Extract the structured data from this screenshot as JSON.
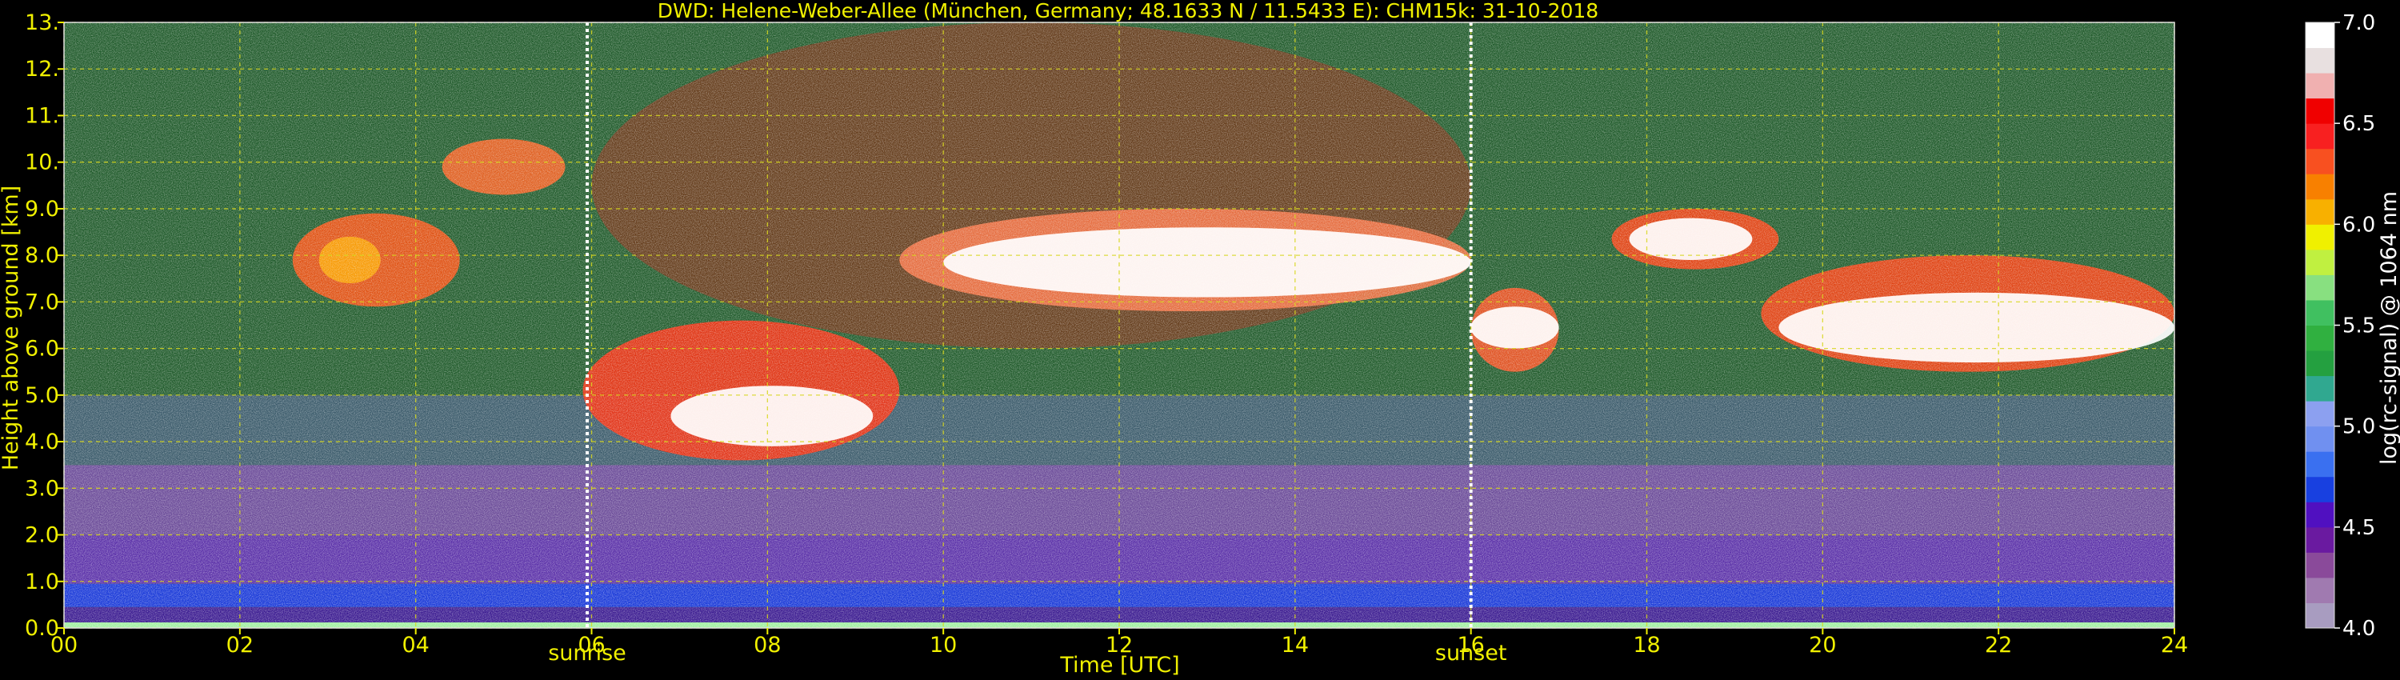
{
  "chart_data": {
    "type": "heatmap",
    "title": "DWD: Helene-Weber-Allee (München, Germany; 48.1633 N / 11.5433 E):    CHM15k: 31-10-2018",
    "xlabel": "Time [UTC]",
    "ylabel": "Height above ground [km]",
    "xlim": [
      0,
      24
    ],
    "ylim": [
      0,
      13
    ],
    "x_ticks": [
      "00",
      "02",
      "04",
      "06",
      "08",
      "10",
      "12",
      "14",
      "16",
      "18",
      "20",
      "22",
      "24"
    ],
    "y_ticks": [
      "0.0",
      "1.0",
      "2.0",
      "3.0",
      "4.0",
      "5.0",
      "6.0",
      "7.0",
      "8.0",
      "9.0",
      "10.",
      "11.",
      "12.",
      "13."
    ],
    "grid": true,
    "events": [
      {
        "label": "sunrise",
        "time": 5.95
      },
      {
        "label": "sunset",
        "time": 16.0
      }
    ],
    "colorbar": {
      "label": "log(rc-signal) @ 1064 nm",
      "range": [
        4.0,
        7.0
      ],
      "ticks": [
        "4.0",
        "4.5",
        "5.0",
        "5.5",
        "6.0",
        "6.5",
        "7.0"
      ],
      "colors": [
        "#a89cc0",
        "#a07ab0",
        "#8a4a9a",
        "#6a1aa0",
        "#5010c0",
        "#1840e0",
        "#3a70f0",
        "#7090f0",
        "#8ca0f0",
        "#30a890",
        "#24a040",
        "#30b040",
        "#40c060",
        "#88e080",
        "#c0f040",
        "#f0f000",
        "#f8b000",
        "#f88000",
        "#f85020",
        "#f82020",
        "#f00000",
        "#f0b0b0",
        "#e8e0e0",
        "#ffffff"
      ]
    },
    "background_bands": [
      {
        "from": 0.0,
        "to": 0.12,
        "color": "#a0f0a0"
      },
      {
        "from": 0.12,
        "to": 0.45,
        "color": "#3a1a90"
      },
      {
        "from": 0.45,
        "to": 0.95,
        "color": "#1838d8"
      },
      {
        "from": 0.95,
        "to": 2.0,
        "color": "#5a30a8"
      },
      {
        "from": 2.0,
        "to": 3.5,
        "color": "#6a4a98"
      },
      {
        "from": 3.5,
        "to": 5.0,
        "color": "#3a5a6a"
      },
      {
        "from": 5.0,
        "to": 13.0,
        "color": "#1f5a2a"
      }
    ],
    "signal_regions": [
      {
        "name": "daytime noise",
        "t0": 6.0,
        "t1": 16.0,
        "h0": 6.0,
        "h1": 13.0,
        "color": "#6a3a1a"
      },
      {
        "name": "cloud 1 edge",
        "t0": 2.6,
        "t1": 4.5,
        "h0": 6.9,
        "h1": 8.9,
        "color": "#f05010"
      },
      {
        "name": "cloud 1 core",
        "t0": 2.9,
        "t1": 3.6,
        "h0": 7.4,
        "h1": 8.4,
        "color": "#f8a000"
      },
      {
        "name": "cloud 2",
        "t0": 4.3,
        "t1": 5.7,
        "h0": 9.3,
        "h1": 10.5,
        "color": "#f06020"
      },
      {
        "name": "low cloud edge",
        "t0": 5.9,
        "t1": 9.5,
        "h0": 3.6,
        "h1": 6.6,
        "color": "#f03010"
      },
      {
        "name": "low cloud core",
        "t0": 6.9,
        "t1": 9.2,
        "h0": 3.9,
        "h1": 5.2,
        "color": "#ffffff"
      },
      {
        "name": "mid cloud edge",
        "t0": 9.5,
        "t1": 16.0,
        "h0": 6.8,
        "h1": 9.0,
        "color": "#f07040"
      },
      {
        "name": "mid cloud core",
        "t0": 10.0,
        "t1": 16.0,
        "h0": 7.1,
        "h1": 8.6,
        "color": "#ffffff"
      },
      {
        "name": "evening cloud edge",
        "t0": 16.0,
        "t1": 17.0,
        "h0": 5.5,
        "h1": 7.3,
        "color": "#f05020"
      },
      {
        "name": "evening cloud core",
        "t0": 16.0,
        "t1": 17.0,
        "h0": 6.0,
        "h1": 6.9,
        "color": "#ffffff"
      },
      {
        "name": "late cloud 1 edge",
        "t0": 17.6,
        "t1": 19.5,
        "h0": 7.7,
        "h1": 9.0,
        "color": "#f04010"
      },
      {
        "name": "late cloud 1 core",
        "t0": 17.8,
        "t1": 19.2,
        "h0": 7.9,
        "h1": 8.8,
        "color": "#ffffff"
      },
      {
        "name": "late cloud 2 edge",
        "t0": 19.3,
        "t1": 24.0,
        "h0": 5.5,
        "h1": 8.0,
        "color": "#f04010"
      },
      {
        "name": "late cloud 2 core",
        "t0": 19.5,
        "t1": 24.0,
        "h0": 5.7,
        "h1": 7.2,
        "color": "#ffffff"
      }
    ]
  }
}
